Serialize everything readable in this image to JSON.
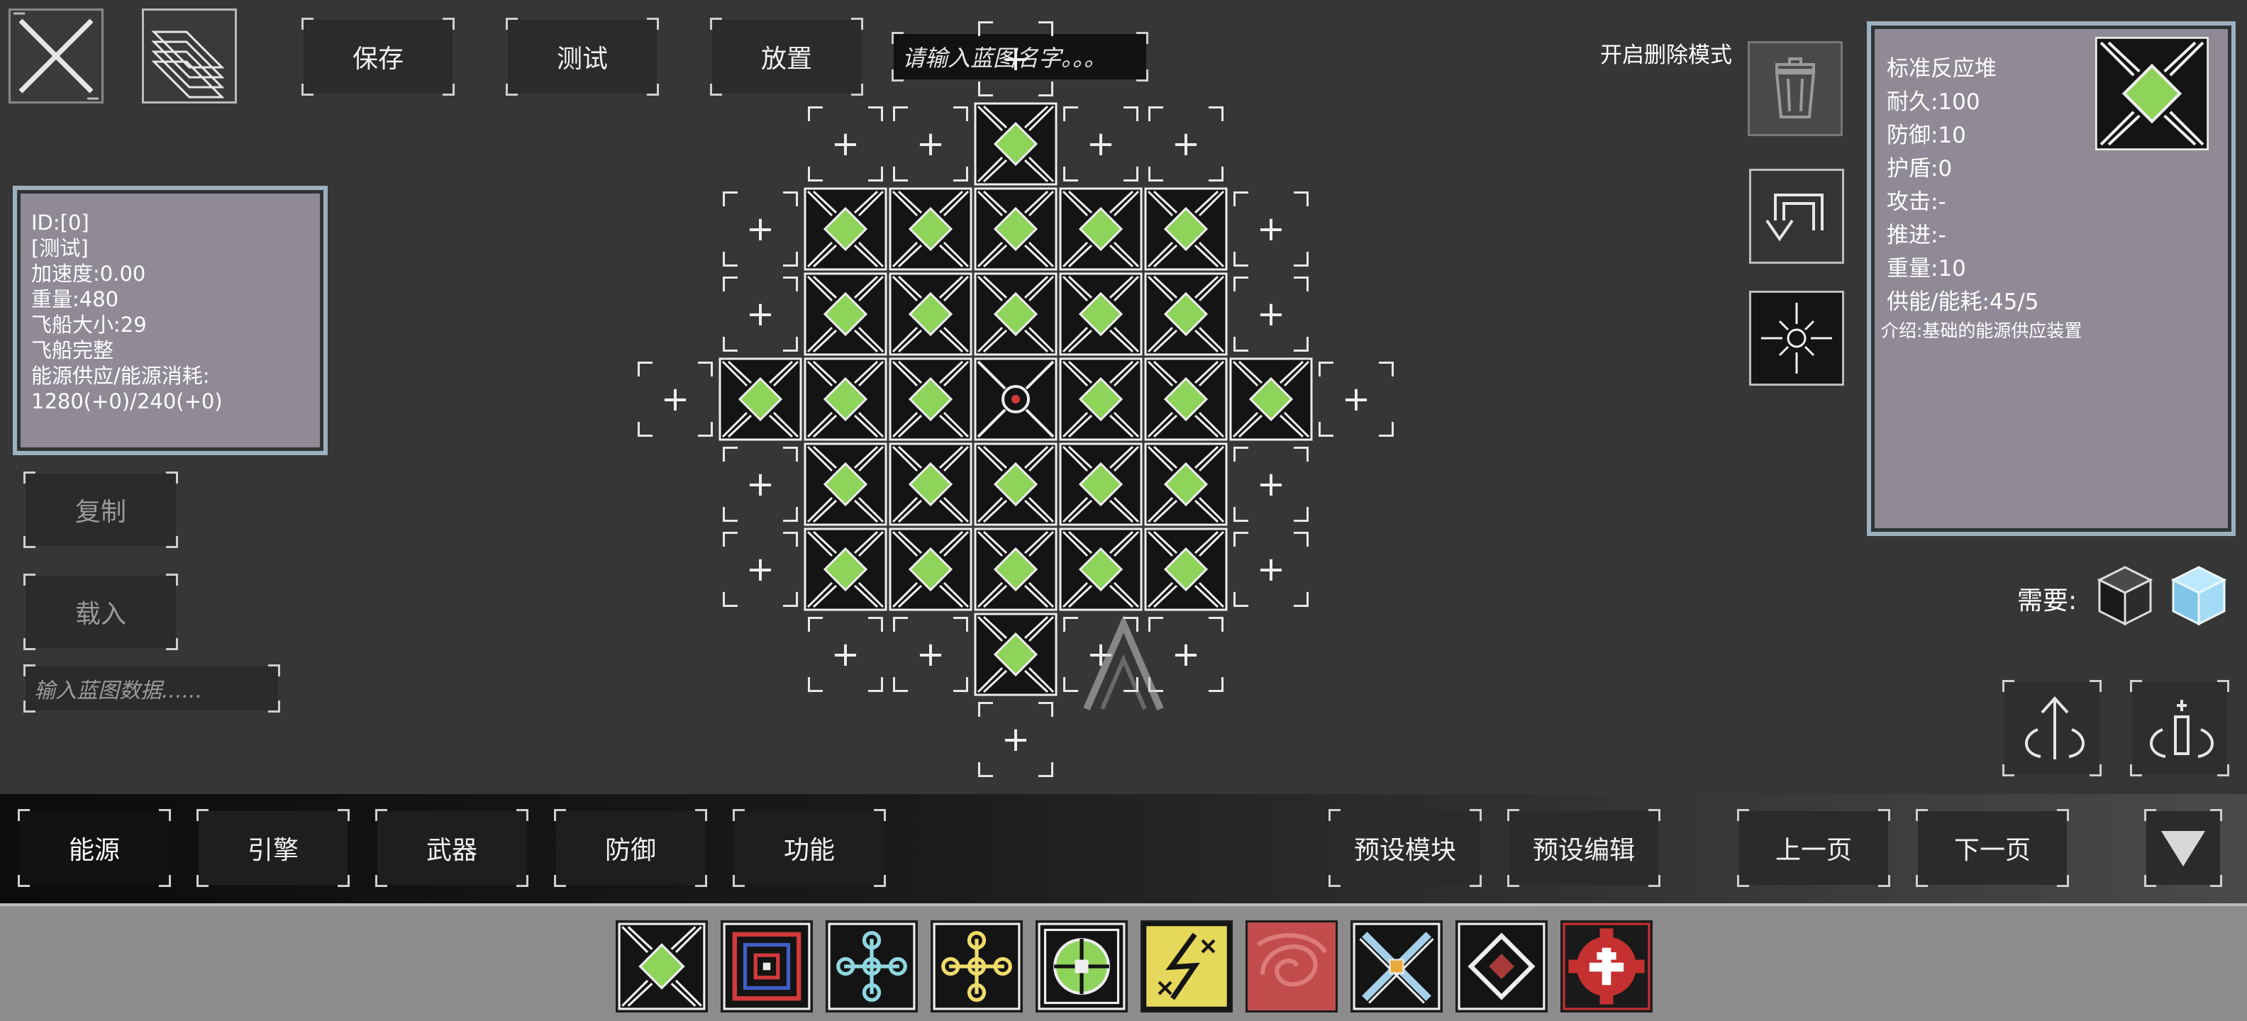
{
  "top_buttons": {
    "save": "保存",
    "test": "测试",
    "place": "放置"
  },
  "name_input": {
    "placeholder": "请输入蓝图名字。。。"
  },
  "ship_stats": {
    "lines": [
      "ID:[0]",
      "[测试]",
      "加速度:0.00",
      "重量:480",
      "飞船大小:29",
      "飞船完整",
      "能源供应/能源消耗:",
      "1280(+0)/240(+0)"
    ]
  },
  "left_buttons": {
    "copy": "复制",
    "load": "载入"
  },
  "blueprint_input": {
    "placeholder": "输入蓝图数据......"
  },
  "delete_mode_label": "开启删除模式",
  "module_info": {
    "lines": [
      "标准反应堆",
      "耐久:100",
      "防御:10",
      "护盾:0",
      "攻击:-",
      "推进:-",
      "重量:10",
      "供能/能耗:45/5"
    ],
    "description": "介绍:基础的能源供应装置"
  },
  "requires_label": "需要:",
  "categories": [
    "能源",
    "引擎",
    "武器",
    "防御",
    "功能"
  ],
  "preset_buttons": {
    "module": "预设模块",
    "edit": "预设编辑"
  },
  "paging": {
    "prev": "上一页",
    "next": "下一页"
  },
  "palette_icons": [
    "reactor-icon",
    "red-blue-frame-icon",
    "cyan-cross-icon",
    "yellow-cross-icon",
    "green-circle-grid-icon",
    "yellow-lightning-icon",
    "red-swirl-icon",
    "blue-x-icon",
    "red-diamond-icon",
    "red-skull-core-icon"
  ],
  "colors": {
    "background": "#363636",
    "panel": "#8f8a96",
    "panel_border": "#9db0be",
    "reactor_green": "#8ed35a",
    "bottom_bar": "#1a1a1a",
    "palette_bar": "#8c8c8c"
  }
}
